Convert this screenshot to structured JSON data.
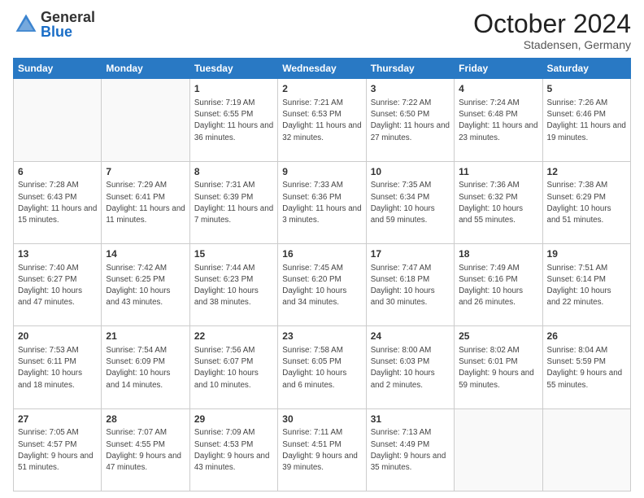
{
  "logo": {
    "general": "General",
    "blue": "Blue"
  },
  "header": {
    "month": "October 2024",
    "location": "Stadensen, Germany"
  },
  "weekdays": [
    "Sunday",
    "Monday",
    "Tuesday",
    "Wednesday",
    "Thursday",
    "Friday",
    "Saturday"
  ],
  "weeks": [
    [
      {
        "day": "",
        "info": ""
      },
      {
        "day": "",
        "info": ""
      },
      {
        "day": "1",
        "info": "Sunrise: 7:19 AM\nSunset: 6:55 PM\nDaylight: 11 hours and 36 minutes."
      },
      {
        "day": "2",
        "info": "Sunrise: 7:21 AM\nSunset: 6:53 PM\nDaylight: 11 hours and 32 minutes."
      },
      {
        "day": "3",
        "info": "Sunrise: 7:22 AM\nSunset: 6:50 PM\nDaylight: 11 hours and 27 minutes."
      },
      {
        "day": "4",
        "info": "Sunrise: 7:24 AM\nSunset: 6:48 PM\nDaylight: 11 hours and 23 minutes."
      },
      {
        "day": "5",
        "info": "Sunrise: 7:26 AM\nSunset: 6:46 PM\nDaylight: 11 hours and 19 minutes."
      }
    ],
    [
      {
        "day": "6",
        "info": "Sunrise: 7:28 AM\nSunset: 6:43 PM\nDaylight: 11 hours and 15 minutes."
      },
      {
        "day": "7",
        "info": "Sunrise: 7:29 AM\nSunset: 6:41 PM\nDaylight: 11 hours and 11 minutes."
      },
      {
        "day": "8",
        "info": "Sunrise: 7:31 AM\nSunset: 6:39 PM\nDaylight: 11 hours and 7 minutes."
      },
      {
        "day": "9",
        "info": "Sunrise: 7:33 AM\nSunset: 6:36 PM\nDaylight: 11 hours and 3 minutes."
      },
      {
        "day": "10",
        "info": "Sunrise: 7:35 AM\nSunset: 6:34 PM\nDaylight: 10 hours and 59 minutes."
      },
      {
        "day": "11",
        "info": "Sunrise: 7:36 AM\nSunset: 6:32 PM\nDaylight: 10 hours and 55 minutes."
      },
      {
        "day": "12",
        "info": "Sunrise: 7:38 AM\nSunset: 6:29 PM\nDaylight: 10 hours and 51 minutes."
      }
    ],
    [
      {
        "day": "13",
        "info": "Sunrise: 7:40 AM\nSunset: 6:27 PM\nDaylight: 10 hours and 47 minutes."
      },
      {
        "day": "14",
        "info": "Sunrise: 7:42 AM\nSunset: 6:25 PM\nDaylight: 10 hours and 43 minutes."
      },
      {
        "day": "15",
        "info": "Sunrise: 7:44 AM\nSunset: 6:23 PM\nDaylight: 10 hours and 38 minutes."
      },
      {
        "day": "16",
        "info": "Sunrise: 7:45 AM\nSunset: 6:20 PM\nDaylight: 10 hours and 34 minutes."
      },
      {
        "day": "17",
        "info": "Sunrise: 7:47 AM\nSunset: 6:18 PM\nDaylight: 10 hours and 30 minutes."
      },
      {
        "day": "18",
        "info": "Sunrise: 7:49 AM\nSunset: 6:16 PM\nDaylight: 10 hours and 26 minutes."
      },
      {
        "day": "19",
        "info": "Sunrise: 7:51 AM\nSunset: 6:14 PM\nDaylight: 10 hours and 22 minutes."
      }
    ],
    [
      {
        "day": "20",
        "info": "Sunrise: 7:53 AM\nSunset: 6:11 PM\nDaylight: 10 hours and 18 minutes."
      },
      {
        "day": "21",
        "info": "Sunrise: 7:54 AM\nSunset: 6:09 PM\nDaylight: 10 hours and 14 minutes."
      },
      {
        "day": "22",
        "info": "Sunrise: 7:56 AM\nSunset: 6:07 PM\nDaylight: 10 hours and 10 minutes."
      },
      {
        "day": "23",
        "info": "Sunrise: 7:58 AM\nSunset: 6:05 PM\nDaylight: 10 hours and 6 minutes."
      },
      {
        "day": "24",
        "info": "Sunrise: 8:00 AM\nSunset: 6:03 PM\nDaylight: 10 hours and 2 minutes."
      },
      {
        "day": "25",
        "info": "Sunrise: 8:02 AM\nSunset: 6:01 PM\nDaylight: 9 hours and 59 minutes."
      },
      {
        "day": "26",
        "info": "Sunrise: 8:04 AM\nSunset: 5:59 PM\nDaylight: 9 hours and 55 minutes."
      }
    ],
    [
      {
        "day": "27",
        "info": "Sunrise: 7:05 AM\nSunset: 4:57 PM\nDaylight: 9 hours and 51 minutes."
      },
      {
        "day": "28",
        "info": "Sunrise: 7:07 AM\nSunset: 4:55 PM\nDaylight: 9 hours and 47 minutes."
      },
      {
        "day": "29",
        "info": "Sunrise: 7:09 AM\nSunset: 4:53 PM\nDaylight: 9 hours and 43 minutes."
      },
      {
        "day": "30",
        "info": "Sunrise: 7:11 AM\nSunset: 4:51 PM\nDaylight: 9 hours and 39 minutes."
      },
      {
        "day": "31",
        "info": "Sunrise: 7:13 AM\nSunset: 4:49 PM\nDaylight: 9 hours and 35 minutes."
      },
      {
        "day": "",
        "info": ""
      },
      {
        "day": "",
        "info": ""
      }
    ]
  ]
}
